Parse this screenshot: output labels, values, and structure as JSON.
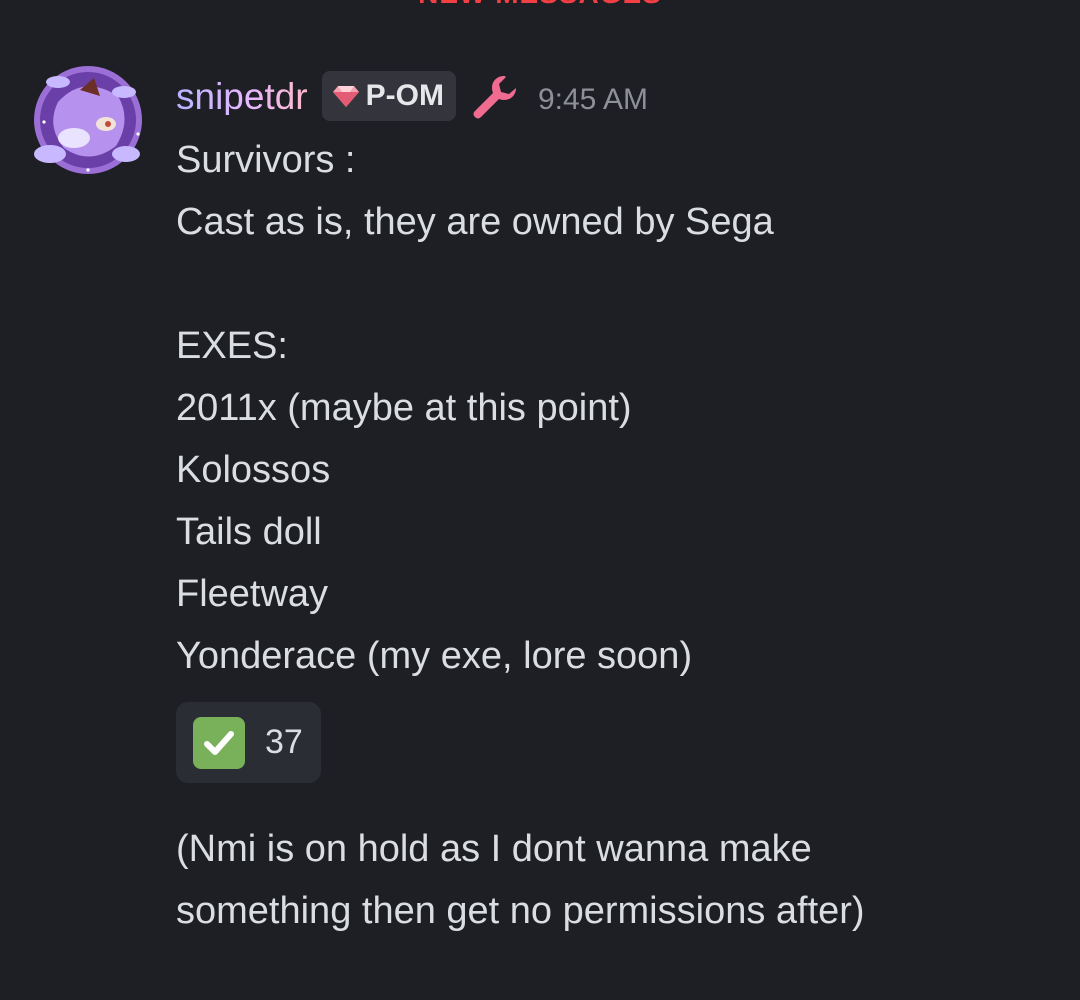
{
  "divider": {
    "label": "NEW MESSAGES"
  },
  "message": {
    "author": "snipetdr",
    "role_tag": "P-OM",
    "timestamp": "9:45 AM",
    "lines": [
      "Survivors :",
      "Cast as is, they are owned by Sega",
      "",
      "EXES:",
      "2011x (maybe at this point)",
      "Kolossos",
      "Tails doll",
      "Fleetway",
      "Yonderace (my exe, lore soon)"
    ],
    "reaction": {
      "emoji": "white-check-mark-icon",
      "count": "37"
    }
  },
  "followup": {
    "lines": [
      "(Nmi is on hold as I dont wanna make",
      "something then get no permissions after)"
    ]
  },
  "colors": {
    "background": "#1e1f24",
    "text": "#dbdee1",
    "timestamp": "#8d9097",
    "divider": "#f23f43",
    "wrench": "#ef6b8f",
    "reaction_bg": "#2b2d34",
    "check": "#78b159"
  }
}
